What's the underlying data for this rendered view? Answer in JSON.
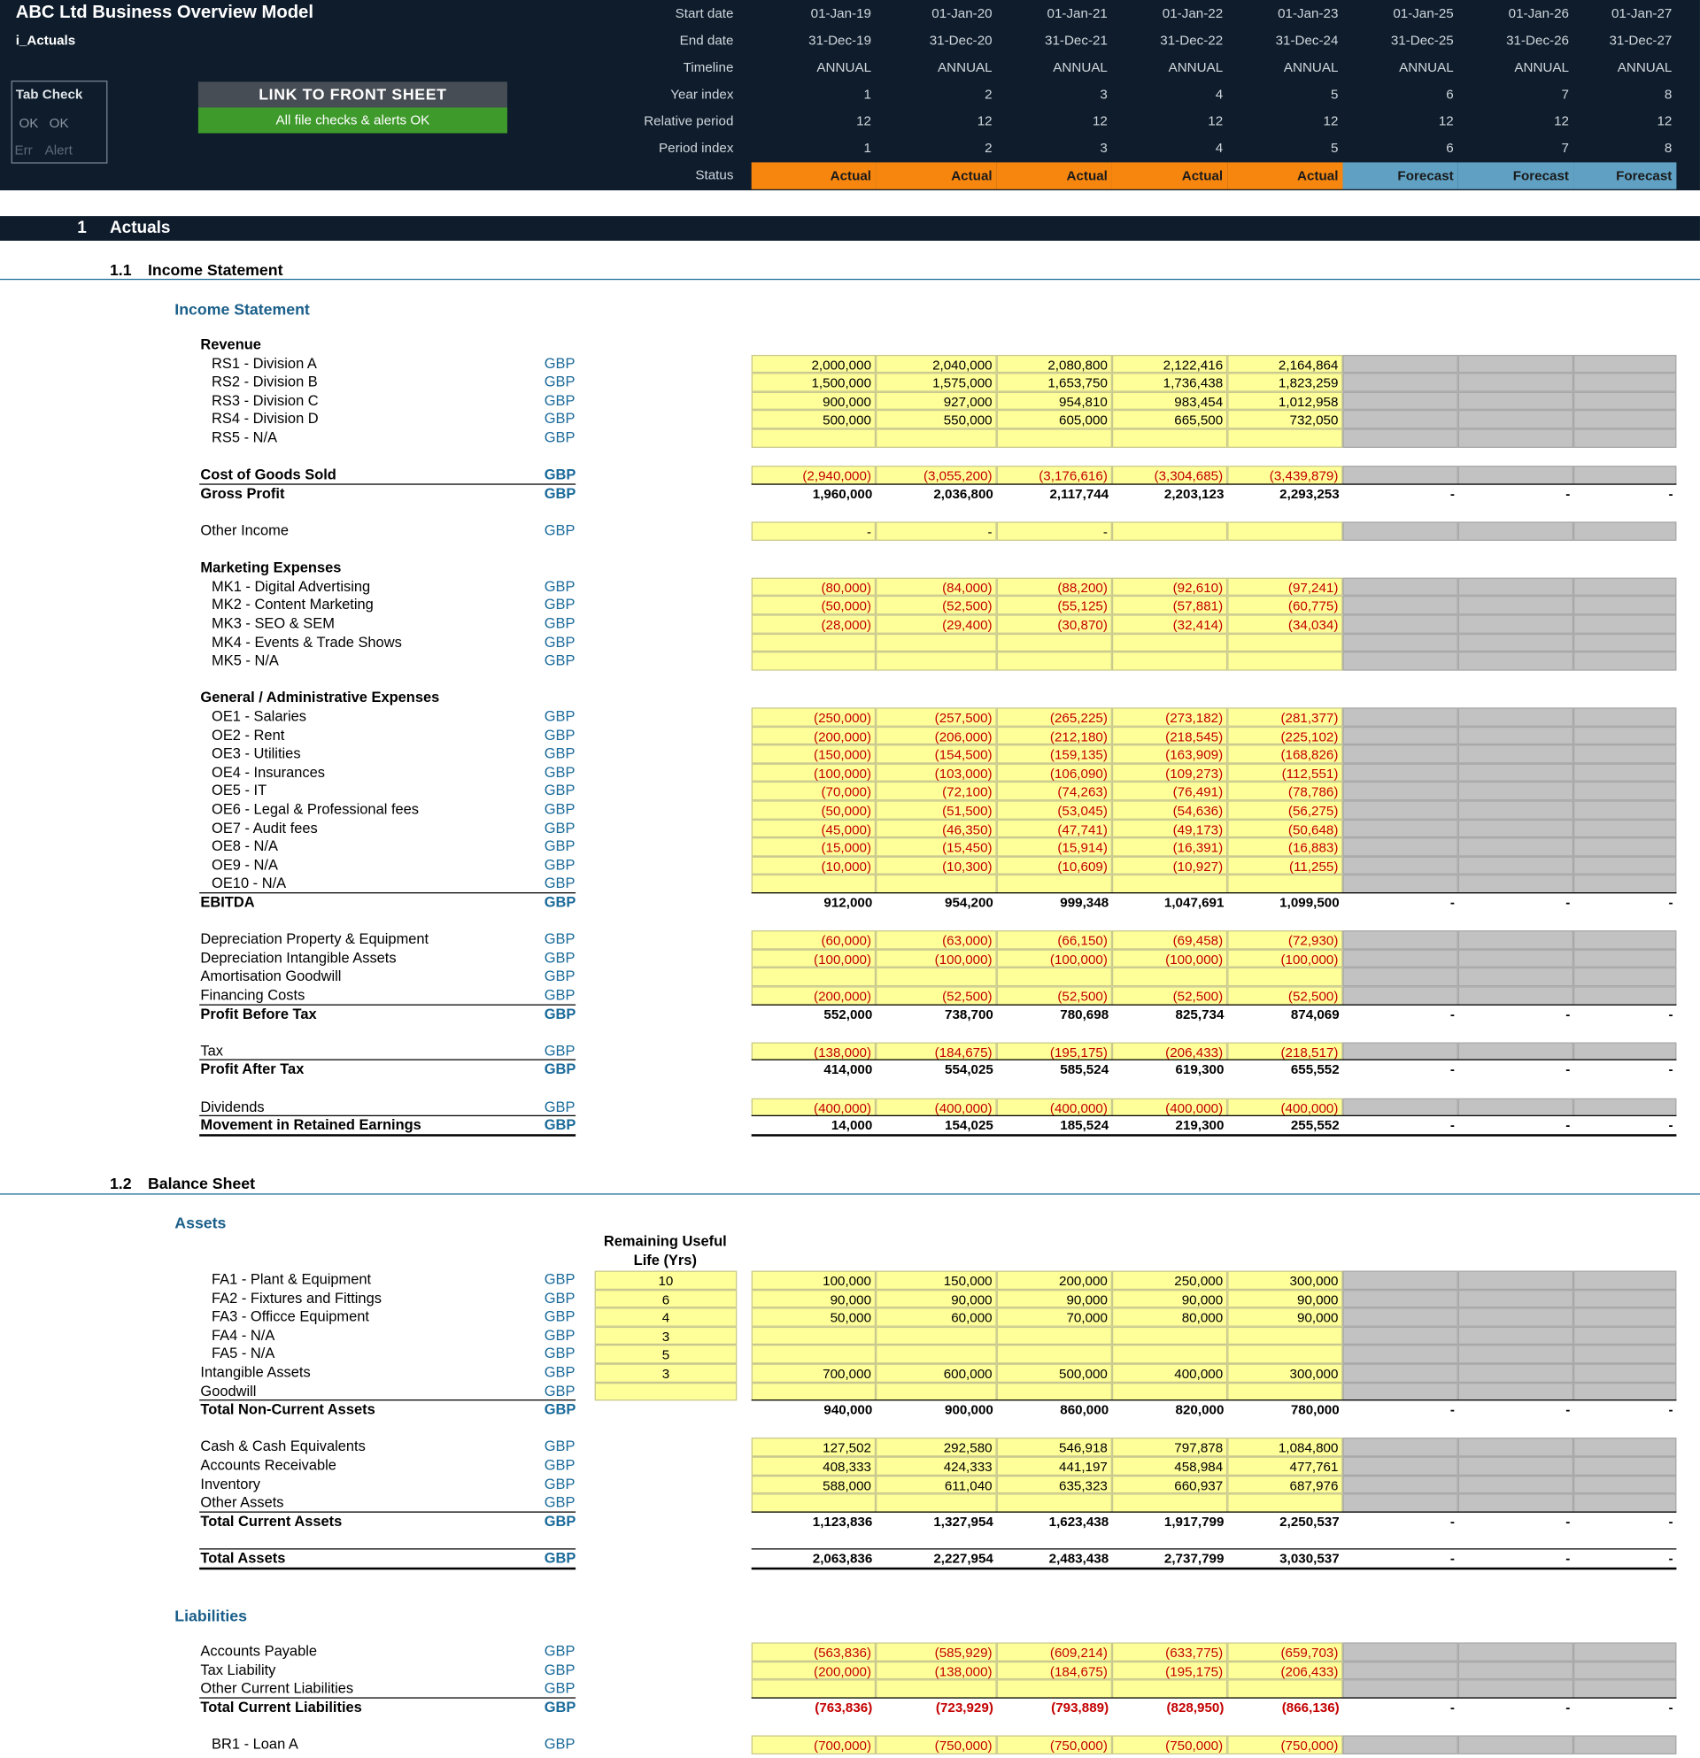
{
  "header": {
    "title": "ABC Ltd Business Overview Model",
    "sheet": "i_Actuals",
    "tab_check": {
      "title": "Tab Check",
      "ok1": "OK",
      "ok2": "OK",
      "err": "Err",
      "alert": "Alert"
    },
    "link_button": "LINK TO FRONT SHEET",
    "checks_status": "All file checks & alerts OK",
    "row_labels": [
      "Start date",
      "End date",
      "Timeline",
      "Year index",
      "Relative period",
      "Period index",
      "Status"
    ],
    "start_dates": [
      "01-Jan-19",
      "01-Jan-20",
      "01-Jan-21",
      "01-Jan-22",
      "01-Jan-23",
      "01-Jan-25",
      "01-Jan-26",
      "01-Jan-27"
    ],
    "end_dates": [
      "31-Dec-19",
      "31-Dec-20",
      "31-Dec-21",
      "31-Dec-22",
      "31-Dec-24",
      "31-Dec-25",
      "31-Dec-26",
      "31-Dec-27"
    ],
    "timeline": [
      "ANNUAL",
      "ANNUAL",
      "ANNUAL",
      "ANNUAL",
      "ANNUAL",
      "ANNUAL",
      "ANNUAL",
      "ANNUAL"
    ],
    "year_index": [
      "1",
      "2",
      "3",
      "4",
      "5",
      "6",
      "7",
      "8"
    ],
    "relative_period": [
      "12",
      "12",
      "12",
      "12",
      "12",
      "12",
      "12",
      "12"
    ],
    "period_index": [
      "1",
      "2",
      "3",
      "4",
      "5",
      "6",
      "7",
      "8"
    ],
    "status": [
      "Actual",
      "Actual",
      "Actual",
      "Actual",
      "Actual",
      "Forecast",
      "Forecast",
      "Forecast"
    ]
  },
  "colors": {
    "header_bg": "#0e1c2c",
    "actual": "#f7860f",
    "forecast": "#5fa0c3",
    "input_yellow": "#ffff99",
    "forecast_grey": "#c2c2c2",
    "negative": "#c40000",
    "unit_blue": "#1a6a9a"
  },
  "section": {
    "num": "1",
    "title": "Actuals"
  },
  "income": {
    "sub_num": "1.1",
    "sub_title": "Income Statement",
    "heading": "Income Statement",
    "rows": [
      {
        "label": "Revenue",
        "kind": "group"
      },
      {
        "label": "RS1 - Division A",
        "unit": "GBP",
        "kind": "input",
        "vals": [
          "2,000,000",
          "2,040,000",
          "2,080,800",
          "2,122,416",
          "2,164,864"
        ]
      },
      {
        "label": "RS2 - Division B",
        "unit": "GBP",
        "kind": "input",
        "vals": [
          "1,500,000",
          "1,575,000",
          "1,653,750",
          "1,736,438",
          "1,823,259"
        ]
      },
      {
        "label": "RS3 - Division C",
        "unit": "GBP",
        "kind": "input",
        "vals": [
          "900,000",
          "927,000",
          "954,810",
          "983,454",
          "1,012,958"
        ]
      },
      {
        "label": "RS4 - Division D",
        "unit": "GBP",
        "kind": "input",
        "vals": [
          "500,000",
          "550,000",
          "605,000",
          "665,500",
          "732,050"
        ]
      },
      {
        "label": "RS5 - N/A",
        "unit": "GBP",
        "kind": "input",
        "vals": [
          "",
          "",
          "",
          "",
          ""
        ]
      },
      {
        "kind": "blank"
      },
      {
        "label": "Cost of Goods Sold",
        "unit": "GBP",
        "kind": "input",
        "bold": true,
        "vals": [
          "(2,940,000)",
          "(3,055,200)",
          "(3,176,616)",
          "(3,304,685)",
          "(3,439,879)"
        ]
      },
      {
        "label": "Gross Profit",
        "unit": "GBP",
        "kind": "total",
        "vals": [
          "1,960,000",
          "2,036,800",
          "2,117,744",
          "2,203,123",
          "2,293,253",
          "-",
          "-",
          "-"
        ]
      },
      {
        "kind": "blank"
      },
      {
        "label": "Other Income",
        "unit": "GBP",
        "kind": "input",
        "vals": [
          "-",
          "-",
          "-",
          "",
          ""
        ]
      },
      {
        "kind": "blank"
      },
      {
        "label": "Marketing Expenses",
        "kind": "group"
      },
      {
        "label": "MK1 - Digital Advertising",
        "unit": "GBP",
        "kind": "input",
        "vals": [
          "(80,000)",
          "(84,000)",
          "(88,200)",
          "(92,610)",
          "(97,241)"
        ]
      },
      {
        "label": "MK2 - Content Marketing",
        "unit": "GBP",
        "kind": "input",
        "vals": [
          "(50,000)",
          "(52,500)",
          "(55,125)",
          "(57,881)",
          "(60,775)"
        ]
      },
      {
        "label": "MK3 - SEO & SEM",
        "unit": "GBP",
        "kind": "input",
        "vals": [
          "(28,000)",
          "(29,400)",
          "(30,870)",
          "(32,414)",
          "(34,034)"
        ]
      },
      {
        "label": "MK4 - Events & Trade Shows",
        "unit": "GBP",
        "kind": "input",
        "vals": [
          "",
          "",
          "",
          "",
          ""
        ]
      },
      {
        "label": "MK5 - N/A",
        "unit": "GBP",
        "kind": "input",
        "vals": [
          "",
          "",
          "",
          "",
          ""
        ]
      },
      {
        "kind": "blank"
      },
      {
        "label": "General / Administrative Expenses",
        "kind": "group"
      },
      {
        "label": "OE1 - Salaries",
        "unit": "GBP",
        "kind": "input",
        "vals": [
          "(250,000)",
          "(257,500)",
          "(265,225)",
          "(273,182)",
          "(281,377)"
        ]
      },
      {
        "label": "OE2 - Rent",
        "unit": "GBP",
        "kind": "input",
        "vals": [
          "(200,000)",
          "(206,000)",
          "(212,180)",
          "(218,545)",
          "(225,102)"
        ]
      },
      {
        "label": "OE3 - Utilities",
        "unit": "GBP",
        "kind": "input",
        "vals": [
          "(150,000)",
          "(154,500)",
          "(159,135)",
          "(163,909)",
          "(168,826)"
        ]
      },
      {
        "label": "OE4 - Insurances",
        "unit": "GBP",
        "kind": "input",
        "vals": [
          "(100,000)",
          "(103,000)",
          "(106,090)",
          "(109,273)",
          "(112,551)"
        ]
      },
      {
        "label": "OE5 - IT",
        "unit": "GBP",
        "kind": "input",
        "vals": [
          "(70,000)",
          "(72,100)",
          "(74,263)",
          "(76,491)",
          "(78,786)"
        ]
      },
      {
        "label": "OE6 - Legal & Professional fees",
        "unit": "GBP",
        "kind": "input",
        "vals": [
          "(50,000)",
          "(51,500)",
          "(53,045)",
          "(54,636)",
          "(56,275)"
        ]
      },
      {
        "label": "OE7 - Audit fees",
        "unit": "GBP",
        "kind": "input",
        "vals": [
          "(45,000)",
          "(46,350)",
          "(47,741)",
          "(49,173)",
          "(50,648)"
        ]
      },
      {
        "label": "OE8 - N/A",
        "unit": "GBP",
        "kind": "input",
        "vals": [
          "(15,000)",
          "(15,450)",
          "(15,914)",
          "(16,391)",
          "(16,883)"
        ]
      },
      {
        "label": "OE9 - N/A",
        "unit": "GBP",
        "kind": "input",
        "vals": [
          "(10,000)",
          "(10,300)",
          "(10,609)",
          "(10,927)",
          "(11,255)"
        ]
      },
      {
        "label": "OE10 - N/A",
        "unit": "GBP",
        "kind": "input",
        "vals": [
          "",
          "",
          "",
          "",
          ""
        ]
      },
      {
        "label": "EBITDA",
        "unit": "GBP",
        "kind": "total",
        "vals": [
          "912,000",
          "954,200",
          "999,348",
          "1,047,691",
          "1,099,500",
          "-",
          "-",
          "-"
        ]
      },
      {
        "kind": "blank"
      },
      {
        "label": "Depreciation Property & Equipment",
        "unit": "GBP",
        "kind": "input",
        "vals": [
          "(60,000)",
          "(63,000)",
          "(66,150)",
          "(69,458)",
          "(72,930)"
        ]
      },
      {
        "label": "Depreciation Intangible Assets",
        "unit": "GBP",
        "kind": "input",
        "vals": [
          "(100,000)",
          "(100,000)",
          "(100,000)",
          "(100,000)",
          "(100,000)"
        ]
      },
      {
        "label": "Amortisation Goodwill",
        "unit": "GBP",
        "kind": "input",
        "vals": [
          "",
          "",
          "",
          "",
          ""
        ]
      },
      {
        "label": "Financing Costs",
        "unit": "GBP",
        "kind": "input",
        "vals": [
          "(200,000)",
          "(52,500)",
          "(52,500)",
          "(52,500)",
          "(52,500)"
        ]
      },
      {
        "label": "Profit Before Tax",
        "unit": "GBP",
        "kind": "total",
        "vals": [
          "552,000",
          "738,700",
          "780,698",
          "825,734",
          "874,069",
          "-",
          "-",
          "-"
        ]
      },
      {
        "kind": "blank"
      },
      {
        "label": "Tax",
        "unit": "GBP",
        "kind": "input",
        "vals": [
          "(138,000)",
          "(184,675)",
          "(195,175)",
          "(206,433)",
          "(218,517)"
        ]
      },
      {
        "label": "Profit After Tax",
        "unit": "GBP",
        "kind": "total",
        "vals": [
          "414,000",
          "554,025",
          "585,524",
          "619,300",
          "655,552",
          "-",
          "-",
          "-"
        ]
      },
      {
        "kind": "blank"
      },
      {
        "label": "Dividends",
        "unit": "GBP",
        "kind": "input",
        "vals": [
          "(400,000)",
          "(400,000)",
          "(400,000)",
          "(400,000)",
          "(400,000)"
        ]
      },
      {
        "label": "Movement in Retained Earnings",
        "unit": "GBP",
        "kind": "total",
        "double": true,
        "vals": [
          "14,000",
          "154,025",
          "185,524",
          "219,300",
          "255,552",
          "-",
          "-",
          "-"
        ]
      }
    ]
  },
  "balance": {
    "sub_num": "1.2",
    "sub_title": "Balance Sheet",
    "assets_heading": "Assets",
    "rul_header": [
      "Remaining Useful",
      "Life (Yrs)"
    ],
    "asset_rows": [
      {
        "label": "FA1 - Plant & Equipment",
        "unit": "GBP",
        "kind": "input",
        "rul": "10",
        "vals": [
          "100,000",
          "150,000",
          "200,000",
          "250,000",
          "300,000"
        ]
      },
      {
        "label": "FA2 - Fixtures and Fittings",
        "unit": "GBP",
        "kind": "input",
        "rul": "6",
        "vals": [
          "90,000",
          "90,000",
          "90,000",
          "90,000",
          "90,000"
        ]
      },
      {
        "label": "FA3 - Officce Equipment",
        "unit": "GBP",
        "kind": "input",
        "rul": "4",
        "vals": [
          "50,000",
          "60,000",
          "70,000",
          "80,000",
          "90,000"
        ]
      },
      {
        "label": "FA4 - N/A",
        "unit": "GBP",
        "kind": "input",
        "rul": "3",
        "vals": [
          "",
          "",
          "",
          "",
          ""
        ]
      },
      {
        "label": "FA5 - N/A",
        "unit": "GBP",
        "kind": "input",
        "rul": "5",
        "vals": [
          "",
          "",
          "",
          "",
          ""
        ]
      },
      {
        "label": "Intangible Assets",
        "unit": "GBP",
        "kind": "input",
        "rul": "3",
        "vals": [
          "700,000",
          "600,000",
          "500,000",
          "400,000",
          "300,000"
        ]
      },
      {
        "label": "Goodwill",
        "unit": "GBP",
        "kind": "input",
        "rul": "",
        "vals": [
          "",
          "",
          "",
          "",
          ""
        ]
      },
      {
        "label": "Total Non-Current Assets",
        "unit": "GBP",
        "kind": "total",
        "vals": [
          "940,000",
          "900,000",
          "860,000",
          "820,000",
          "780,000",
          "-",
          "-",
          "-"
        ]
      },
      {
        "kind": "blank"
      },
      {
        "label": "Cash & Cash Equivalents",
        "unit": "GBP",
        "kind": "input",
        "vals": [
          "127,502",
          "292,580",
          "546,918",
          "797,878",
          "1,084,800"
        ]
      },
      {
        "label": "Accounts Receivable",
        "unit": "GBP",
        "kind": "input",
        "vals": [
          "408,333",
          "424,333",
          "441,197",
          "458,984",
          "477,761"
        ]
      },
      {
        "label": "Inventory",
        "unit": "GBP",
        "kind": "input",
        "vals": [
          "588,000",
          "611,040",
          "635,323",
          "660,937",
          "687,976"
        ]
      },
      {
        "label": "Other Assets",
        "unit": "GBP",
        "kind": "input",
        "vals": [
          "",
          "",
          "",
          "",
          ""
        ]
      },
      {
        "label": "Total Current Assets",
        "unit": "GBP",
        "kind": "total",
        "vals": [
          "1,123,836",
          "1,327,954",
          "1,623,438",
          "1,917,799",
          "2,250,537",
          "-",
          "-",
          "-"
        ]
      },
      {
        "kind": "blank"
      },
      {
        "label": "Total Assets",
        "unit": "GBP",
        "kind": "total",
        "double": true,
        "vals": [
          "2,063,836",
          "2,227,954",
          "2,483,438",
          "2,737,799",
          "3,030,537",
          "-",
          "-",
          "-"
        ]
      }
    ],
    "liabilities_heading": "Liabilities",
    "liability_rows": [
      {
        "label": "Accounts Payable",
        "unit": "GBP",
        "kind": "input",
        "vals": [
          "(563,836)",
          "(585,929)",
          "(609,214)",
          "(633,775)",
          "(659,703)"
        ]
      },
      {
        "label": "Tax Liability",
        "unit": "GBP",
        "kind": "input",
        "vals": [
          "(200,000)",
          "(138,000)",
          "(184,675)",
          "(195,175)",
          "(206,433)"
        ]
      },
      {
        "label": "Other Current Liabilities",
        "unit": "GBP",
        "kind": "input",
        "vals": [
          "",
          "",
          "",
          "",
          ""
        ]
      },
      {
        "label": "Total Current Liabilities",
        "unit": "GBP",
        "kind": "total",
        "vals": [
          "(763,836)",
          "(723,929)",
          "(793,889)",
          "(828,950)",
          "(866,136)",
          "-",
          "-",
          "-"
        ]
      },
      {
        "kind": "blank"
      },
      {
        "label": "BR1 - Loan A",
        "unit": "GBP",
        "kind": "input",
        "vals": [
          "(700,000)",
          "(750,000)",
          "(750,000)",
          "(750,000)",
          "(750,000)"
        ]
      }
    ]
  }
}
